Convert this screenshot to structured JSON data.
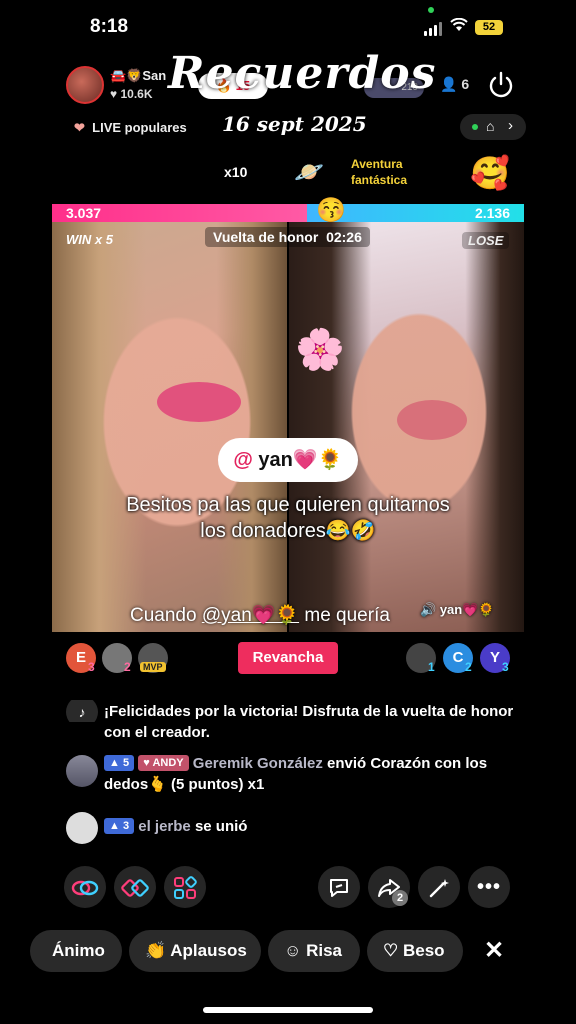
{
  "status": {
    "time": "8:18",
    "battery": "52"
  },
  "header": {
    "host_name": "San",
    "host_likes": "10.6K",
    "pill_count": "15",
    "overlay_title": "Recuerdos",
    "overlay_date": "16 sept 2025",
    "small_badge": "210",
    "viewers": "6",
    "live_popular": "LIVE populares"
  },
  "promo": {
    "multiplier": "x10",
    "event_name": "Aventura fantástica"
  },
  "battle": {
    "left_score": "3.037",
    "right_score": "2.136",
    "win_label": "WIN x 5",
    "round_label": "Vuelta de honor",
    "timer": "02:26",
    "lose_label": "LOSE",
    "mention": "yan💗🌻",
    "caption": "Besitos pa las que quieren quitarnos los donadores😂🤣",
    "bottom_text_before": "Cuando",
    "bottom_mention": "@yan💗🌻",
    "bottom_text_after": "me quería",
    "speaker_label": "yan💗🌻"
  },
  "supporters": {
    "left": [
      {
        "initial": "E",
        "rank": "3",
        "color": "#e2553a"
      },
      {
        "initial": "",
        "rank": "2",
        "color": "#777"
      },
      {
        "initial": "",
        "rank": "MVP",
        "color": "#555"
      }
    ],
    "right": [
      {
        "initial": "",
        "rank": "1",
        "color": "#444"
      },
      {
        "initial": "C",
        "rank": "2",
        "color": "#2b8de0"
      },
      {
        "initial": "Y",
        "rank": "3",
        "color": "#4a3cc8"
      }
    ],
    "rematch_label": "Revancha"
  },
  "chat": [
    {
      "text": "¡Felicidades por la victoria! Disfruta de la vuelta de honor con el creador."
    },
    {
      "level": "5",
      "fan": "ANDY",
      "user": "Geremik González",
      "action": "envió Corazón con los dedos🫰 (5 puntos) x1"
    },
    {
      "level": "3",
      "user": "el jerbe",
      "action": "se unió"
    }
  ],
  "reactions": [
    "Ánimo",
    "Aplausos",
    "Risa",
    "Beso"
  ],
  "share_count": "2"
}
